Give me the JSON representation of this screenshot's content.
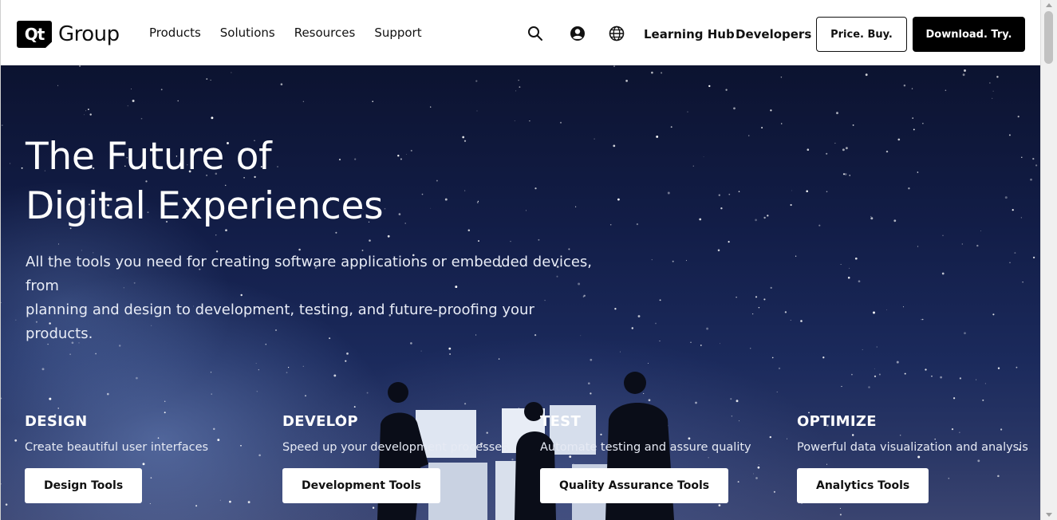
{
  "header": {
    "logo": {
      "mark": "Qt",
      "word": "Group"
    },
    "nav": [
      {
        "label": "Products"
      },
      {
        "label": "Solutions"
      },
      {
        "label": "Resources"
      },
      {
        "label": "Support"
      }
    ],
    "icons": {
      "search": "search-icon",
      "account": "user-account-icon",
      "language": "globe-icon"
    },
    "links": {
      "learning_hub": "Learning Hub",
      "developers": "Developers"
    },
    "buttons": {
      "price_buy": "Price. Buy.",
      "download_try": "Download. Try."
    }
  },
  "hero": {
    "title": "The Future of\nDigital Experiences",
    "subtitle": "All the tools you need for creating software applications or embedded devices, from\nplanning and design to development, testing, and future-proofing your products.",
    "columns": [
      {
        "heading": "DESIGN",
        "description": "Create beautiful user interfaces",
        "button": "Design Tools"
      },
      {
        "heading": "DEVELOP",
        "description": "Speed up your development processes",
        "button": "Development Tools"
      },
      {
        "heading": "TEST",
        "description": "Automate testing and assure quality",
        "button": "Quality Assurance Tools"
      },
      {
        "heading": "OPTIMIZE",
        "description": "Powerful data visualization and analysis",
        "button": "Analytics Tools"
      }
    ]
  },
  "colors": {
    "header_bg": "#ffffff",
    "primary_button": "#000000",
    "hero_sky_top": "#0c1330",
    "hero_sky_bottom": "#3a4470",
    "hero_text": "#ffffff"
  }
}
